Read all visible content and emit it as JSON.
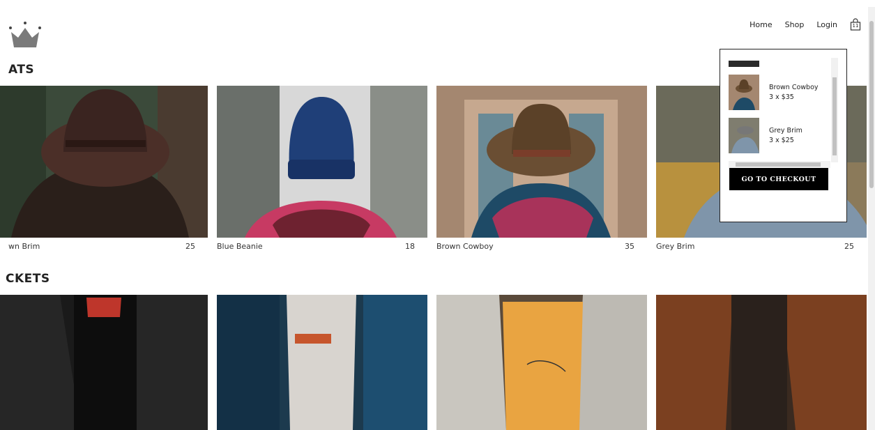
{
  "nav": {
    "home": "Home",
    "shop": "Shop",
    "login": "Login",
    "cart_count": "11"
  },
  "sections": [
    {
      "title": "ATS"
    },
    {
      "title": "CKETS"
    }
  ],
  "hats": [
    {
      "name": "wn Brim",
      "price": "25"
    },
    {
      "name": "Blue Beanie",
      "price": "18"
    },
    {
      "name": "Brown Cowboy",
      "price": "35"
    },
    {
      "name": "Grey Brim",
      "price": "25"
    }
  ],
  "cart": {
    "items": [
      {
        "name": "Brown Cowboy",
        "qty": "3 x $35"
      },
      {
        "name": "Grey Brim",
        "qty": "3 x $25"
      }
    ],
    "checkout_label": "GO TO CHECKOUT"
  },
  "icons": {
    "logo": "crown-logo",
    "cart": "shopping-bag-icon"
  }
}
